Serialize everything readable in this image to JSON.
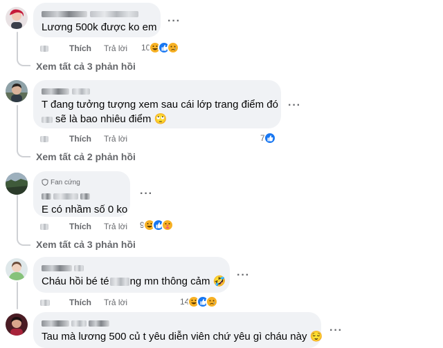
{
  "comments": [
    {
      "text": "Lương 500k được ko em",
      "like_label": "Thích",
      "reply_label": "Trả lời",
      "reaction_count": "10",
      "reactions": [
        "haha",
        "like",
        "sad"
      ],
      "view_replies": "Xem tất cả 3 phản hồi"
    },
    {
      "text_line1": "T đang tưởng tượng xem sau cái lớp trang điểm đó",
      "text_line2": "sẽ là bao nhiêu điểm 🙄",
      "like_label": "Thích",
      "reply_label": "Trả lời",
      "reaction_count": "7",
      "reactions": [
        "like"
      ],
      "view_replies": "Xem tất cả 2 phản hồi"
    },
    {
      "badge": "Fan cứng",
      "text": "E có nhầm số 0 ko",
      "like_label": "Thích",
      "reply_label": "Trả lời",
      "reaction_count": "9",
      "reactions": [
        "haha",
        "like",
        "care"
      ],
      "view_replies": "Xem tất cả 3 phản hồi"
    },
    {
      "text_before": "Cháu hồi bé té",
      "text_after": "ng mn thông cảm 🤣",
      "like_label": "Thích",
      "reply_label": "Trả lời",
      "reaction_count": "14",
      "reactions": [
        "haha",
        "like",
        "sad"
      ]
    },
    {
      "text": "Tau mà lương 500 củ t yêu diễn viên chứ yêu gì cháu này 😌"
    }
  ],
  "more_glyph": "···",
  "colors": {
    "bubble": "#f0f2f5",
    "muted": "#65676b",
    "like_blue": "#1877f2",
    "haha_yellow": "#f7b125"
  }
}
